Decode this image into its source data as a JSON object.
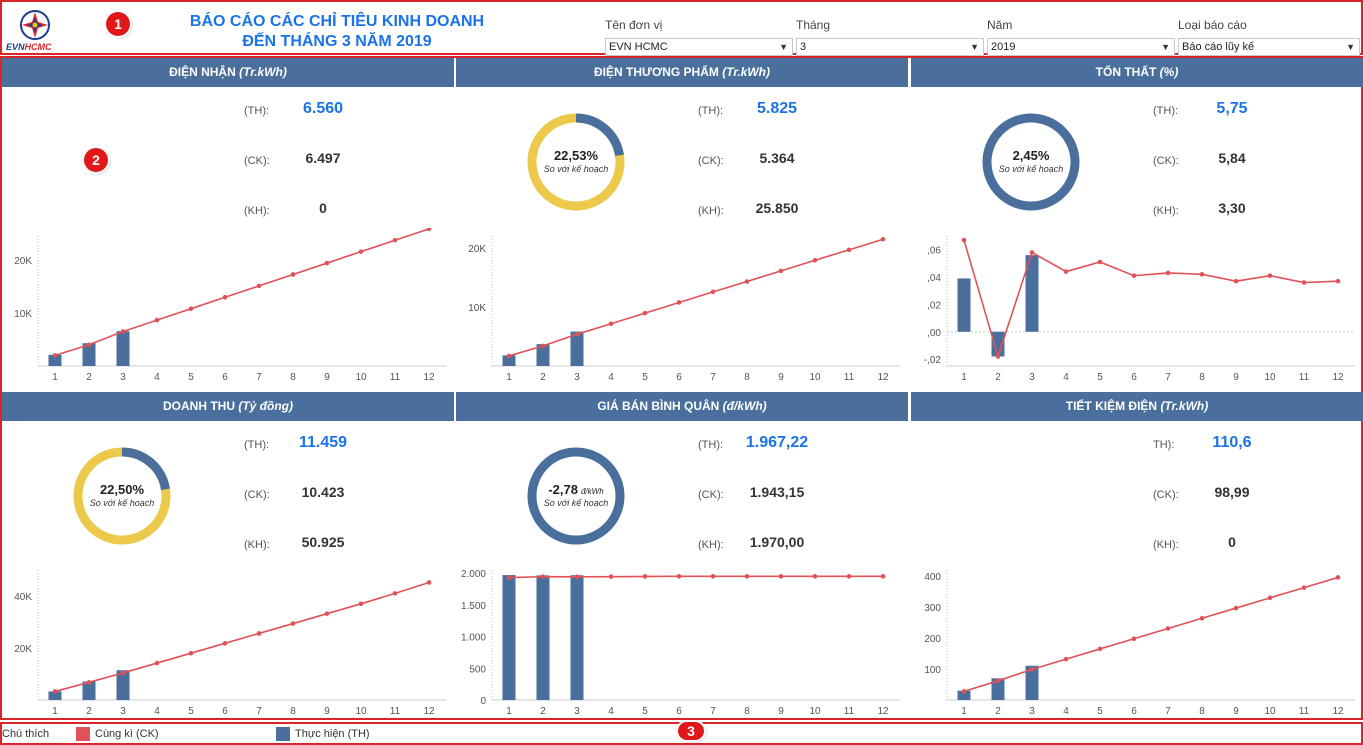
{
  "header": {
    "logo_text": "EVN HCMC",
    "title_line1": "BÁO CÁO CÁC CHỈ TIÊU KINH DOANH",
    "title_line2": "ĐẾN THÁNG 3 NĂM 2019",
    "markers": [
      "1",
      "2",
      "3"
    ],
    "filters": [
      {
        "label": "Tên đơn vị",
        "value": "EVN HCMC"
      },
      {
        "label": "Tháng",
        "value": "3"
      },
      {
        "label": "Năm",
        "value": "2019"
      },
      {
        "label": "Loại báo cáo",
        "value": "Báo cáo lũy kế"
      }
    ]
  },
  "kpi_labels": {
    "th": "(TH):",
    "th_plain": "TH):",
    "ck": "(CK):",
    "kh": "(KH):"
  },
  "colors": {
    "header_bar": "#4a6f9c",
    "bar": "#4a6f9c",
    "line": "#e05258",
    "donut_fill": "#4a6f9c",
    "donut_rest": "#ecc94b",
    "accent": "#1a73e8"
  },
  "panels": [
    {
      "title": "ĐIỆN NHẬN ",
      "unit": "(Tr.kWh)",
      "th_label_key": "th",
      "th": "6.560",
      "ck": "6.497",
      "kh": "0",
      "donut": null
    },
    {
      "title": "ĐIỆN THƯƠNG PHẨM ",
      "unit": "(Tr.kWh)",
      "th_label_key": "th",
      "th": "5.825",
      "ck": "5.364",
      "kh": "25.850",
      "donut": {
        "pct": "22,53%",
        "sub": "So với kế hoạch",
        "fraction": 0.2253,
        "full": false
      }
    },
    {
      "title": "TỔN THẤT ",
      "unit": "(%)",
      "th_label_key": "th",
      "th": "5,75",
      "ck": "5,84",
      "kh": "3,30",
      "donut": {
        "pct": "2,45%",
        "sub": "So với kế hoạch",
        "fraction": 1.0,
        "full": true
      }
    },
    {
      "title": "DOANH THU ",
      "unit": "(Tỷ đồng)",
      "th_label_key": "th",
      "th": "11.459",
      "ck": "10.423",
      "kh": "50.925",
      "donut": {
        "pct": "22,50%",
        "sub": "So với kế hoạch",
        "fraction": 0.225,
        "full": false
      }
    },
    {
      "title": "GIÁ BÁN BÌNH QUÂN ",
      "unit": "(đ/kWh)",
      "th_label_key": "th",
      "th": "1.967,22",
      "ck": "1.943,15",
      "kh": "1.970,00",
      "donut": {
        "pct": "-2,78",
        "pct_unit": "đ/kWh",
        "sub": "So với kế hoạch",
        "fraction": 1.0,
        "full": true
      }
    },
    {
      "title": "TIẾT KIỆM ĐIỆN ",
      "unit": "(Tr.kWh)",
      "th_label_key": "th_plain",
      "th": "110,6",
      "ck": "98,99",
      "kh": "0",
      "donut": null
    }
  ],
  "chart_data": [
    {
      "type": "bar",
      "x": [
        1,
        2,
        3,
        4,
        5,
        6,
        7,
        8,
        9,
        10,
        11,
        12
      ],
      "ylim": [
        0,
        24500
      ],
      "yticks": [
        10000,
        20000
      ],
      "ytick_labels": [
        "10K",
        "20K"
      ],
      "series": [
        {
          "name": "Thực hiện (TH)",
          "type": "bar",
          "values": [
            2100,
            4300,
            6560
          ]
        },
        {
          "name": "Cùng kì (CK)",
          "type": "line",
          "values": [
            2000,
            4000,
            6497,
            8650,
            10800,
            12950,
            15100,
            17250,
            19400,
            21550,
            23700,
            25850
          ]
        }
      ]
    },
    {
      "type": "bar",
      "x": [
        1,
        2,
        3,
        4,
        5,
        6,
        7,
        8,
        9,
        10,
        11,
        12
      ],
      "ylim": [
        0,
        22000
      ],
      "yticks": [
        10000,
        20000
      ],
      "ytick_labels": [
        "10K",
        "20K"
      ],
      "series": [
        {
          "name": "Thực hiện (TH)",
          "type": "bar",
          "values": [
            1800,
            3700,
            5825
          ]
        },
        {
          "name": "Cùng kì (CK)",
          "type": "line",
          "values": [
            1700,
            3400,
            5364,
            7150,
            8950,
            10750,
            12550,
            14300,
            16100,
            17900,
            19650,
            21450
          ]
        }
      ]
    },
    {
      "type": "bar",
      "x": [
        1,
        2,
        3,
        4,
        5,
        6,
        7,
        8,
        9,
        10,
        11,
        12
      ],
      "ylim": [
        -0.025,
        0.07
      ],
      "yticks": [
        -0.02,
        0,
        0.02,
        0.04,
        0.06
      ],
      "ytick_labels": [
        "-,02",
        ",00",
        ",02",
        ",04",
        ",06"
      ],
      "series": [
        {
          "name": "Thực hiện (TH)",
          "type": "bar",
          "values": [
            0.039,
            -0.018,
            0.056
          ]
        },
        {
          "name": "Cùng kì (CK)",
          "type": "line",
          "values": [
            0.067,
            -0.018,
            0.058,
            0.044,
            0.051,
            0.041,
            0.043,
            0.042,
            0.037,
            0.041,
            0.036,
            0.037
          ]
        }
      ]
    },
    {
      "type": "bar",
      "x": [
        1,
        2,
        3,
        4,
        5,
        6,
        7,
        8,
        9,
        10,
        11,
        12
      ],
      "ylim": [
        0,
        50000
      ],
      "yticks": [
        20000,
        40000
      ],
      "ytick_labels": [
        "20K",
        "40K"
      ],
      "series": [
        {
          "name": "Thực hiện (TH)",
          "type": "bar",
          "values": [
            3300,
            7100,
            11459
          ]
        },
        {
          "name": "Cùng kì (CK)",
          "type": "line",
          "values": [
            3300,
            6800,
            10423,
            14200,
            18000,
            21800,
            25600,
            29400,
            33200,
            37000,
            41000,
            45200
          ]
        }
      ]
    },
    {
      "type": "bar",
      "x": [
        1,
        2,
        3,
        4,
        5,
        6,
        7,
        8,
        9,
        10,
        11,
        12
      ],
      "ylim": [
        0,
        2050
      ],
      "yticks": [
        0,
        500,
        1000,
        1500,
        2000
      ],
      "ytick_labels": [
        "0",
        "500",
        "1.000",
        "1.500",
        "2.000"
      ],
      "series": [
        {
          "name": "Thực hiện (TH)",
          "type": "bar",
          "values": [
            1970,
            1965,
            1967.22
          ]
        },
        {
          "name": "Cùng kì (CK)",
          "type": "line",
          "values": [
            1930,
            1945,
            1943.15,
            1945,
            1948,
            1950,
            1950,
            1950,
            1950,
            1950,
            1950,
            1950
          ]
        }
      ]
    },
    {
      "type": "bar",
      "x": [
        1,
        2,
        3,
        4,
        5,
        6,
        7,
        8,
        9,
        10,
        11,
        12
      ],
      "ylim": [
        0,
        420
      ],
      "yticks": [
        100,
        200,
        300,
        400
      ],
      "ytick_labels": [
        "100",
        "200",
        "300",
        "400"
      ],
      "series": [
        {
          "name": "Thực hiện (TH)",
          "type": "bar",
          "values": [
            30,
            70,
            110.6
          ]
        },
        {
          "name": "Cùng kì (CK)",
          "type": "line",
          "values": [
            28,
            62,
            98.99,
            132,
            165,
            198,
            231,
            264,
            297,
            330,
            363,
            396
          ]
        }
      ]
    }
  ],
  "legend": {
    "title": "Chú thích",
    "ck_label": "Cùng kì (CK)",
    "th_label": "Thực hiện (TH)"
  }
}
